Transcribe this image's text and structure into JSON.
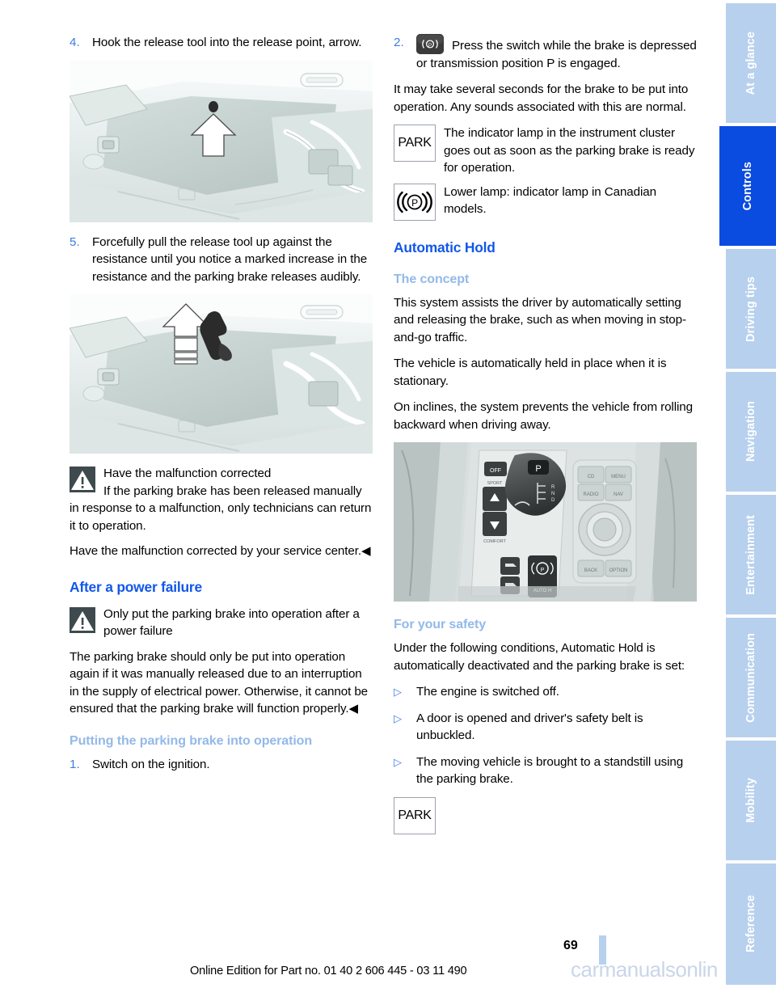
{
  "document": {
    "page_number": "69",
    "footer_note": "Online Edition for Part no. 01 40 2 606 445 - 03 11 490",
    "watermark": "carmanualsonline.info"
  },
  "colors": {
    "heading_blue": "#1157E8",
    "subheading_blue": "#93B9E9",
    "tab_inactive": "#B7D0EE",
    "tab_active": "#0A4BE0",
    "list_marker_blue": "#3D7DE0",
    "warning_box": "#3E4A4D"
  },
  "tabs": [
    {
      "label": "At a glance",
      "active": false
    },
    {
      "label": "Controls",
      "active": true
    },
    {
      "label": "Driving tips",
      "active": false
    },
    {
      "label": "Navigation",
      "active": false
    },
    {
      "label": "Entertainment",
      "active": false
    },
    {
      "label": "Communication",
      "active": false
    },
    {
      "label": "Mobility",
      "active": false
    },
    {
      "label": "Reference",
      "active": false
    }
  ],
  "left_column": {
    "step4": {
      "number": "4.",
      "text": "Hook the release tool into the release point, arrow."
    },
    "figure1_caption": "Luggage compartment floor with release point marked by an arrow",
    "step5": {
      "number": "5.",
      "text": "Forcefully pull the release tool up against the resistance until you notice a marked increase in the resistance and the parking brake releases audibly."
    },
    "figure2_caption": "Release tool being pulled upward, direction shown by arrow",
    "warning1": {
      "icon": "warning-triangle-icon",
      "title": "Have the malfunction corrected",
      "body": "If the parking brake has been released manually in response to a malfunction, only technicians can return it to operation."
    },
    "warning1_paragraph": "Have the malfunction corrected by your service center.◀",
    "heading_after_power_failure": "After a power failure",
    "warning2": {
      "icon": "warning-triangle-icon",
      "title": "Only put the parking brake into operation after a power failure"
    },
    "warning2_paragraph": "The parking brake should only be put into operation again if it was manually released due to an interruption in the supply of electrical power. Otherwise, it cannot be ensured that the parking brake will function properly.◀",
    "heading_putting_into_operation": "Putting the parking brake into operation",
    "step1": {
      "number": "1.",
      "text": "Switch on the ignition."
    }
  },
  "right_column": {
    "step2": {
      "number": "2.",
      "switch_icon": "parking-brake-switch-icon",
      "text": "Press the switch while the brake is depressed or transmission position P is engaged."
    },
    "paragraph_seconds": "It may take several seconds for the brake to be put into operation. Any sounds associated with this are normal.",
    "lamp_rows": [
      {
        "icon_label": "PARK",
        "icon_name": "park-indicator-lamp-icon",
        "text": "The indicator lamp in the instrument cluster goes out as soon as the parking brake is ready for operation."
      },
      {
        "icon_label": "((P))",
        "icon_name": "canadian-parking-brake-lamp-icon",
        "text": "Lower lamp: indicator lamp in Canadian models."
      }
    ],
    "heading_automatic_hold": "Automatic Hold",
    "subheading_concept": "The concept",
    "concept_paragraphs": [
      "This system assists the driver by automatically setting and releasing the brake, such as when moving in stop-and-go traffic.",
      "The vehicle is automatically held in place when it is stationary.",
      "On inclines, the system prevents the vehicle from rolling backward when driving away."
    ],
    "figure3_caption": "Center console with gear selector, iDrive controller and Automatic Hold button",
    "subheading_safety": "For your safety",
    "safety_intro": "Under the following conditions, Automatic Hold is automatically deactivated and the parking brake is set:",
    "safety_bullets": [
      "The engine is switched off.",
      "A door is opened and driver's safety belt is unbuckled.",
      "The moving vehicle is brought to a standstill using the parking brake."
    ],
    "footer_lamp": {
      "icon_label": "PARK",
      "icon_name": "park-indicator-lamp-icon"
    }
  }
}
